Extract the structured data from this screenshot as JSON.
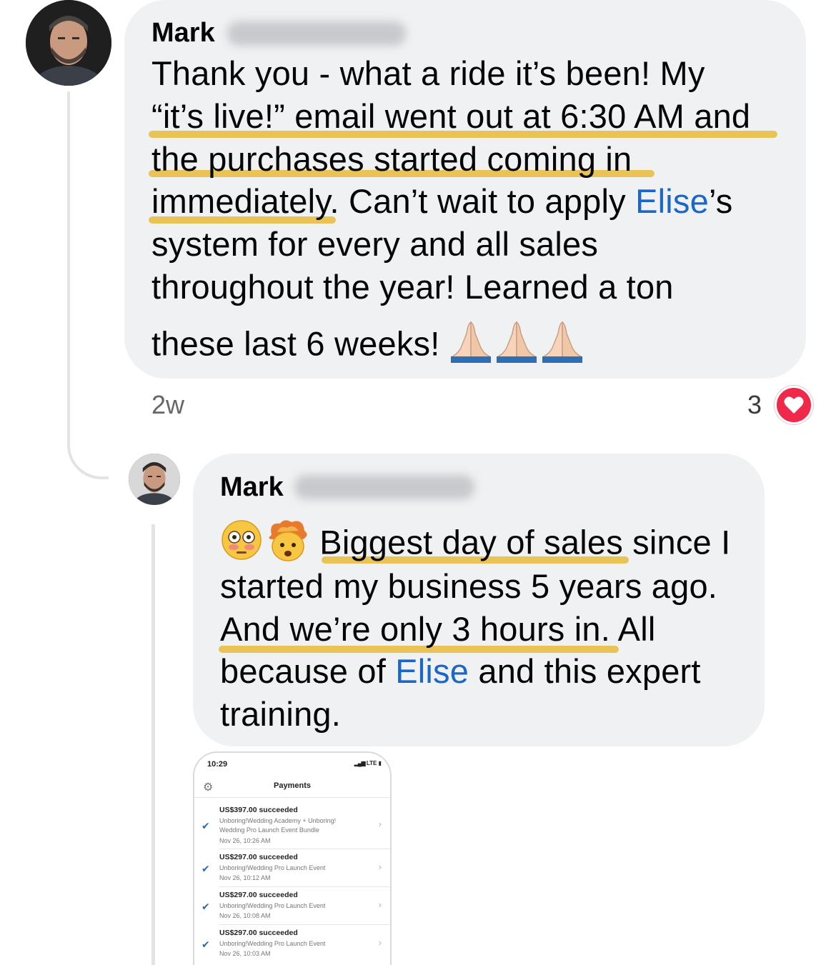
{
  "comment": {
    "author": "Mark",
    "text_lines": [
      "Thank you - what a ride it’s been! My",
      "“it’s live!” email went out at 6:30 AM and",
      "the purchases started coming in",
      "immediately. Can’t wait to apply ",
      "Elise",
      "’s",
      "system for every and all sales",
      "throughout the year! Learned a ton",
      "these last 6 weeks! "
    ],
    "emoji": "folded-hands-icon x3",
    "timestamp": "2w",
    "reaction_count": "3",
    "reaction_type": "heart-icon"
  },
  "reply": {
    "author": "Mark",
    "text_lines": [
      "Biggest day of sales since I",
      "started my business 5 years ago.",
      "And we’re only 3 hours in.",
      " All",
      "because of ",
      "Elise",
      " and this expert",
      "training."
    ],
    "emoji": [
      "flushed-face-icon",
      "exploding-head-icon"
    ]
  },
  "attachment": {
    "status_time": "10:29",
    "status_network": "LTE",
    "screen_title": "Payments",
    "payments": [
      {
        "amount": "US$397.00 succeeded",
        "desc_lines": [
          "Unboring!Wedding Academy + Unboring!",
          "Wedding Pro Launch Event Bundle"
        ],
        "date": "Nov 26, 10:26 AM"
      },
      {
        "amount": "US$297.00 succeeded",
        "desc_lines": [
          "Unboring!Wedding Pro Launch Event"
        ],
        "date": "Nov 26, 10:12 AM"
      },
      {
        "amount": "US$297.00 succeeded",
        "desc_lines": [
          "Unboring!Wedding Pro Launch Event"
        ],
        "date": "Nov 26, 10:08 AM"
      },
      {
        "amount": "US$297.00 succeeded",
        "desc_lines": [
          "Unboring!Wedding Pro Launch Event"
        ],
        "date": "Nov 26, 10:03 AM"
      }
    ]
  },
  "colors": {
    "bubble": "#f0f1f3",
    "mention": "#1b66c9",
    "highlight": "#e9bf4a",
    "heart": "#f0284a",
    "meta": "#65676b"
  }
}
